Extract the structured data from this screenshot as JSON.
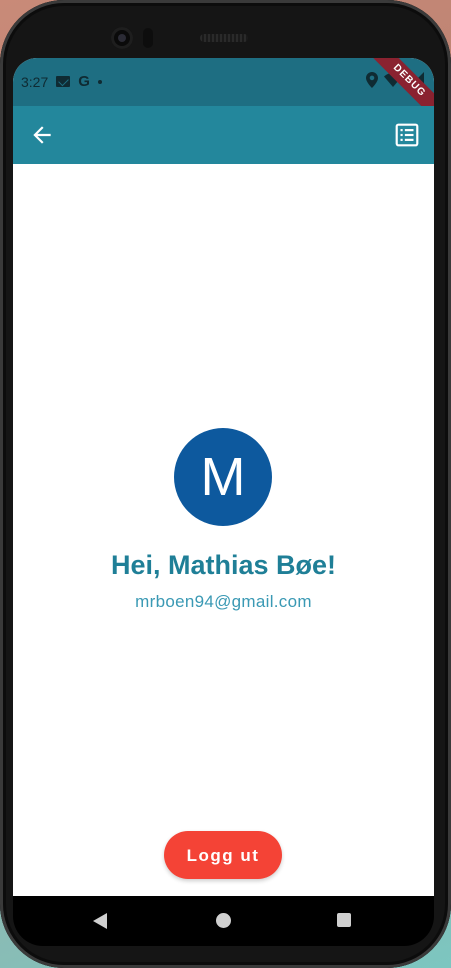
{
  "status_bar": {
    "time": "3:27",
    "icons": [
      "mail-icon",
      "google-icon",
      "dot-icon",
      "location-icon",
      "wifi-icon",
      "signal-icon"
    ],
    "debug_label": "DEBUG"
  },
  "app_bar": {
    "back_icon": "arrow-back-icon",
    "action_icon": "list-icon",
    "color": "#23879c"
  },
  "profile": {
    "avatar_initial": "M",
    "avatar_color": "#0d599e",
    "greeting": "Hei, Mathias Bøe!",
    "email": "mrboen94@gmail.com"
  },
  "actions": {
    "logout_label": "Logg ut",
    "logout_color": "#f44336"
  },
  "nav_bar": {
    "icons": [
      "nav-back-icon",
      "nav-home-icon",
      "nav-recent-icon"
    ]
  }
}
